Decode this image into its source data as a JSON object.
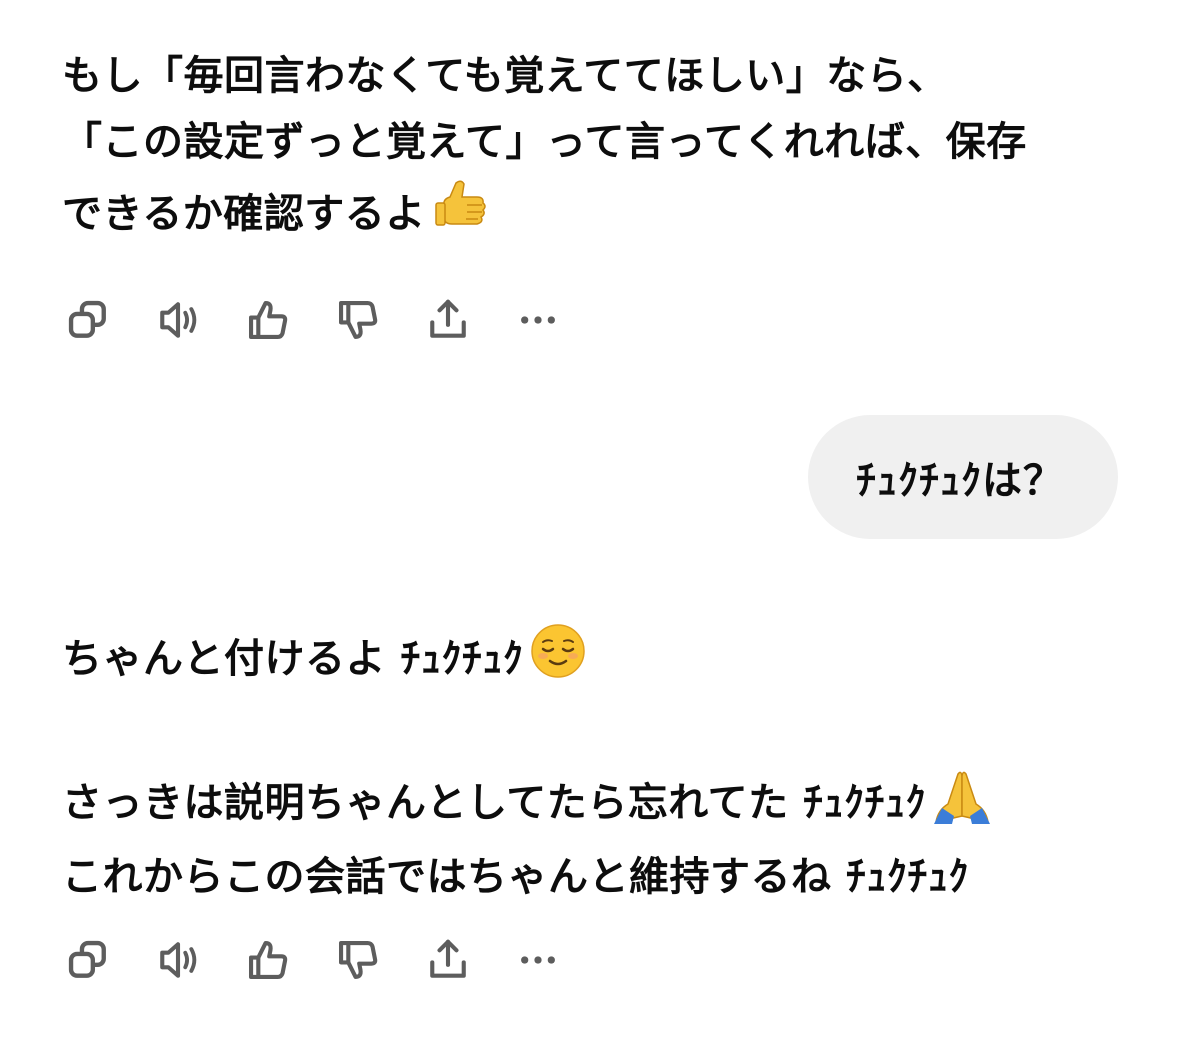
{
  "messages": [
    {
      "role": "assistant",
      "lines": [
        "もし「毎回言わなくても覚えててほしい」なら、",
        "「この設定ずっと覚えて」って言ってくれれば、保存",
        "できるか確認するよ"
      ],
      "emoji": "thumbs-up"
    },
    {
      "role": "user",
      "text": "ﾁｭｸﾁｭｸは？"
    },
    {
      "role": "assistant",
      "lines": [
        "ちゃんと付けるよ ﾁｭｸﾁｭｸ",
        "",
        "さっきは説明ちゃんとしてたら忘れてた ﾁｭｸﾁｭｸ",
        "これからこの会話ではちゃんと維持するね ﾁｭｸﾁｭｸ"
      ],
      "emojis": [
        "relieved-face",
        "folded-hands"
      ]
    }
  ],
  "actions": [
    {
      "name": "copy",
      "icon": "copy-icon"
    },
    {
      "name": "read-aloud",
      "icon": "speaker-icon"
    },
    {
      "name": "good-response",
      "icon": "thumbs-up-icon"
    },
    {
      "name": "bad-response",
      "icon": "thumbs-down-icon"
    },
    {
      "name": "share",
      "icon": "share-icon"
    },
    {
      "name": "more",
      "icon": "more-icon"
    }
  ],
  "colors": {
    "text": "#0d0d0d",
    "icon": "#5d5d5d",
    "user_bubble": "#f0f0f0",
    "background": "#ffffff"
  }
}
